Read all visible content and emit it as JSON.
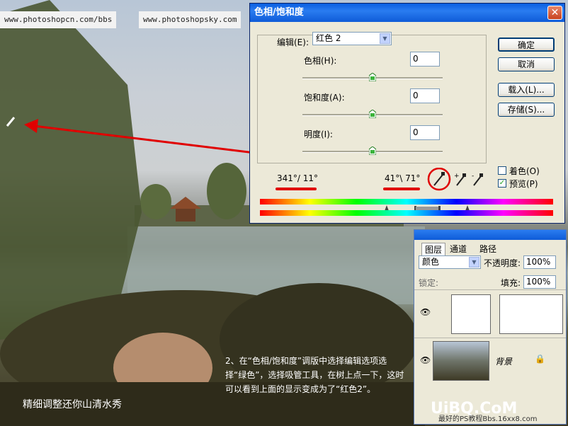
{
  "watermarks": {
    "left": "www.photoshopcn.com/bbs",
    "right": "www.photoshopsky.com"
  },
  "dialog": {
    "title": "色相/饱和度",
    "close": "✕",
    "edit_label": "编辑(E):",
    "edit_value": "红色 2",
    "hue_label": "色相(H):",
    "hue_value": "0",
    "sat_label": "饱和度(A):",
    "sat_value": "0",
    "light_label": "明度(I):",
    "light_value": "0",
    "range_left": "341°/ 11°",
    "range_right": "41°\\ 71°",
    "buttons": {
      "ok": "确定",
      "cancel": "取消",
      "load": "载入(L)...",
      "save": "存储(S)..."
    },
    "colorize_label": "着色(O)",
    "preview_label": "预览(P)",
    "preview_checked": "✓"
  },
  "layers_panel": {
    "tabs": [
      "图层",
      "通道",
      "路径"
    ],
    "blend_mode": "颜色",
    "opacity_label": "不透明度:",
    "opacity_value": "100%",
    "lock_label": "锁定:",
    "fill_label": "填充:",
    "fill_value": "100%",
    "background_layer": "背景",
    "footer_text": "最好的PS教程Bbs.16xx8.com"
  },
  "caption_left": "精细调整还你山清水秀",
  "caption_right": "2、在“色相/饱和度”调版中选择编辑选项选择“绿色”，选择吸管工具，在树上点一下，这时可以看到上面的显示变成为了“红色2”。",
  "logo_text": "UiBQ.CoM",
  "accent_red": "#e00000"
}
